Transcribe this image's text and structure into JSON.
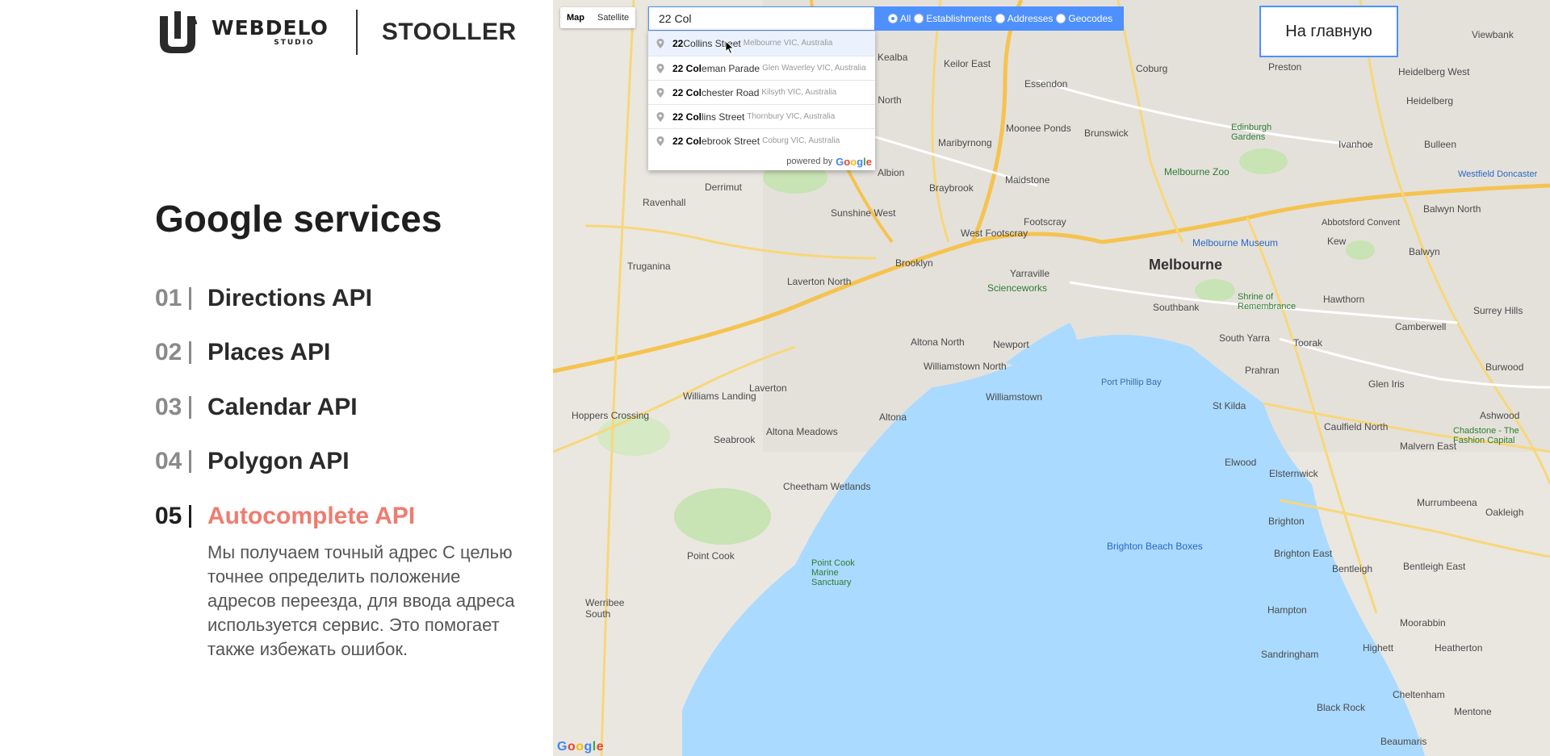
{
  "brand": {
    "logo_word": "WEBDELO",
    "logo_sub": "STUDIO",
    "name": "STOOLLER"
  },
  "heading": "Google services",
  "services": [
    {
      "num": "01",
      "label": "Directions API"
    },
    {
      "num": "02",
      "label": "Places API"
    },
    {
      "num": "03",
      "label": "Calendar API"
    },
    {
      "num": "04",
      "label": "Polygon API"
    },
    {
      "num": "05",
      "label": "Autocomplete API"
    }
  ],
  "active_service_index": 4,
  "active_service_description": "Мы получаем точный адрес С целью точнее определить положение адресов переезда, для ввода адреса используется сервис. Это помогает также избежать ошибок.",
  "accent_color": "#ef7c70",
  "map": {
    "type_options": [
      "Map",
      "Satellite"
    ],
    "selected_type": "Map",
    "search_value": "22 Col",
    "filters": [
      {
        "label": "All",
        "selected": true
      },
      {
        "label": "Establishments",
        "selected": false
      },
      {
        "label": "Addresses",
        "selected": false
      },
      {
        "label": "Geocodes",
        "selected": false
      }
    ],
    "suggestions": [
      {
        "bold": "22",
        "main": " Collins Street",
        "secondary": "Melbourne VIC, Australia"
      },
      {
        "bold": "22 Col",
        "main": "eman Parade",
        "secondary": "Glen Waverley VIC, Australia"
      },
      {
        "bold": "22 Col",
        "main": "chester Road",
        "secondary": "Kilsyth VIC, Australia"
      },
      {
        "bold": "22 Col",
        "main": "lins Street",
        "secondary": "Thornbury VIC, Australia"
      },
      {
        "bold": "22 Col",
        "main": "ebrook Street",
        "secondary": "Coburg VIC, Australia"
      }
    ],
    "powered_by": "powered by",
    "google_word": [
      "G",
      "o",
      "o",
      "g",
      "l",
      "e"
    ],
    "home_button": "На главную",
    "labels": {
      "melbourne": "Melbourne",
      "port_phillip_bay": "Port Phillip Bay",
      "kealba": "Kealba",
      "keilor_east": "Keilor East",
      "essendon": "Essendon",
      "coburg": "Coburg",
      "preston": "Preston",
      "heidelberg": "Heidelberg",
      "brunswick": "Brunswick",
      "moonee_ponds": "Moonee Ponds",
      "maribyrnong": "Maribyrnong",
      "sunshine_north": "Sunshine North",
      "albion": "Albion",
      "maidstone": "Maidstone",
      "braybrook": "Braybrook",
      "sunshine_west": "Sunshine West",
      "footscray": "Footscray",
      "west_footscray": "West Footscray",
      "yarraville": "Yarraville",
      "scienceworks": "Scienceworks",
      "brooklyn": "Brooklyn",
      "laverton_north": "Laverton North",
      "altona_north": "Altona North",
      "newport": "Newport",
      "williamstown_north": "Williamstown North",
      "williamstown": "Williamstown",
      "altona": "Altona",
      "altona_meadows": "Altona Meadows",
      "laverton": "Laverton",
      "seabrook": "Seabrook",
      "williams_landing": "Williams Landing",
      "hoppers_crossing": "Hoppers Crossing",
      "truganina": "Truganina",
      "ravenhall": "Ravenhall",
      "derrimut": "Derrimut",
      "cheetham_wetlands": "Cheetham Wetlands",
      "point_cook": "Point Cook",
      "point_cook_marine": "Point Cook Marine Sanctuary",
      "werribee_south": "Werribee South",
      "southbank": "Southbank",
      "south_yarra": "South Yarra",
      "prahran": "Prahran",
      "st_kilda": "St Kilda",
      "elwood": "Elwood",
      "brighton": "Brighton",
      "brighton_east": "Brighton East",
      "brighton_beach_boxes": "Brighton Beach Boxes",
      "hampton": "Hampton",
      "sandringham": "Sandringham",
      "elsternwick": "Elsternwick",
      "caulfield_north": "Caulfield North",
      "glen_iris": "Glen Iris",
      "toorak": "Toorak",
      "hawthorn": "Hawthorn",
      "kew": "Kew",
      "camberwell": "Camberwell",
      "balwyn": "Balwyn",
      "balwyn_north": "Balwyn North",
      "ivanhoe": "Ivanhoe",
      "bulleen": "Bulleen",
      "viewbank": "Viewbank",
      "heidelberg_west": "Heidelberg West",
      "surrey_hills": "Surrey Hills",
      "burwood": "Burwood",
      "ashwood": "Ashwood",
      "malvern_east": "Malvern East",
      "chadstone": "Chadstone - The Fashion Capital",
      "oakleigh": "Oakleigh",
      "murrumbeena": "Murrumbeena",
      "bentleigh": "Bentleigh",
      "bentleigh_east": "Bentleigh East",
      "moorabbin": "Moorabbin",
      "highett": "Highett",
      "heatherton": "Heatherton",
      "cheltenham": "Cheltenham",
      "mentone": "Mentone",
      "beaumaris": "Beaumaris",
      "black_rock": "Black Rock",
      "edinburgh_gardens": "Edinburgh Gardens",
      "melbourne_zoo": "Melbourne Zoo",
      "melbourne_museum": "Melbourne Museum",
      "shrine": "Shrine of Remembrance",
      "abbotsford_convent": "Abbotsford Convent",
      "westfield_doncaster": "Westfield Doncaster"
    }
  }
}
